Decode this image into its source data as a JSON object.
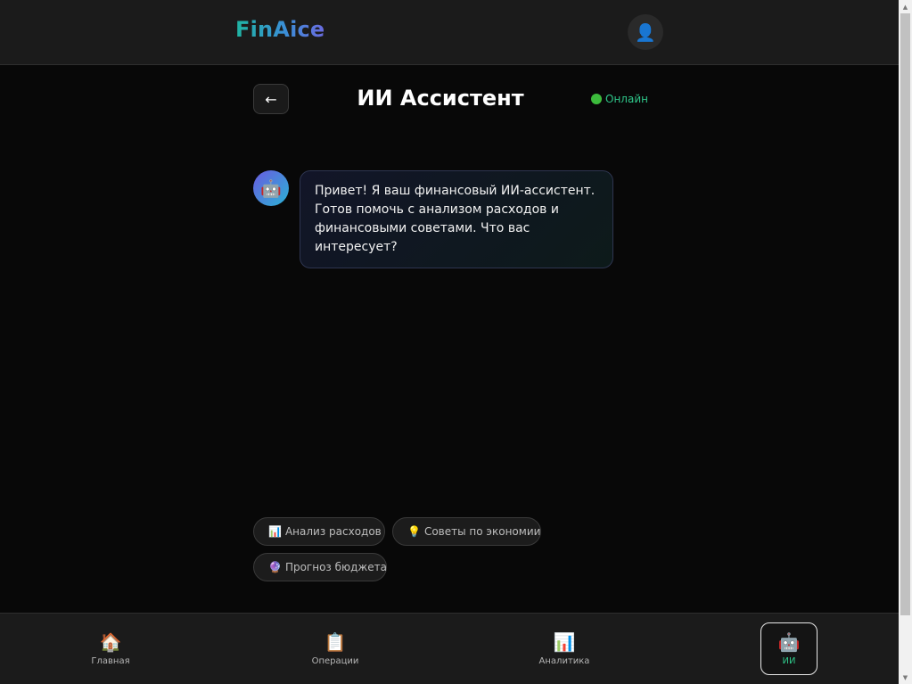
{
  "header": {
    "logo": "FinAice",
    "profile_icon": "👤"
  },
  "chat": {
    "back_icon": "←",
    "title": "ИИ Ассистент",
    "status": "Онлайн",
    "status_color": "#2fc78a"
  },
  "messages": [
    {
      "sender": "bot",
      "avatar_icon": "🤖",
      "text": "Привет! Я ваш финансовый ИИ-ассистент. Готов помочь с анализом расходов и финансовыми советами. Что вас интересует?"
    }
  ],
  "quick_actions": [
    {
      "icon": "📊",
      "label": "Анализ расходов"
    },
    {
      "icon": "💡",
      "label": "Советы по экономии"
    },
    {
      "icon": "🔮",
      "label": "Прогноз бюджета"
    }
  ],
  "nav": {
    "items": [
      {
        "icon": "🏠",
        "label": "Главная",
        "active": false
      },
      {
        "icon": "📋",
        "label": "Операции",
        "active": false
      },
      {
        "icon": "📊",
        "label": "Аналитика",
        "active": false
      },
      {
        "icon": "🤖",
        "label": "ИИ",
        "active": true
      }
    ],
    "active_color": "#2fc78a"
  },
  "colors": {
    "background": "#080808",
    "panel": "#1b1b1b",
    "accent_green": "#2fc78a"
  }
}
